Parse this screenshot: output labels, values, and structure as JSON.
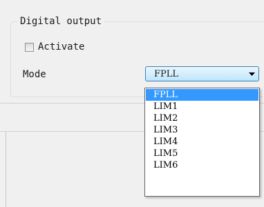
{
  "group": {
    "title": "Digital output"
  },
  "activate": {
    "label": "Activate",
    "checked": false
  },
  "mode": {
    "label": "Mode",
    "selected": "FPLL",
    "options": [
      "FPLL",
      "LIM1",
      "LIM2",
      "LIM3",
      "LIM4",
      "LIM5",
      "LIM6"
    ],
    "highlighted_index": 0
  },
  "colors": {
    "highlight": "#3399ff",
    "combo_border": "#3c7fb1",
    "panel_bg": "#f0f0f0"
  },
  "icons": {
    "combo_arrow": "chevron-down-icon"
  }
}
